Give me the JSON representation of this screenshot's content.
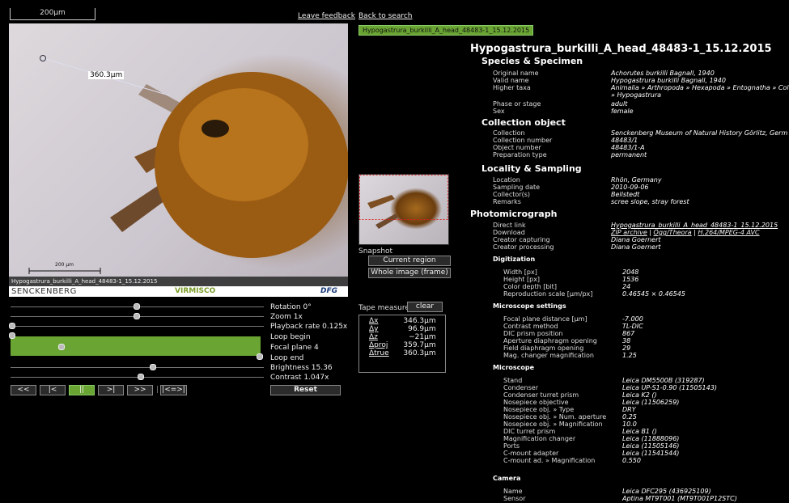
{
  "viewer": {
    "scale_top": "200μm",
    "scale_bottom": "200 μm",
    "measure_label": "360.3μm",
    "caption": "Hypogastrura_burkilli_A_head_48483-1_15.12.2015",
    "logo_left": "SENCKENBERG",
    "logo_mid": "VIRMISCO",
    "logo_right": "DFG"
  },
  "links": {
    "feedback": "Leave feedback",
    "back": "Back to search"
  },
  "tag": "Hypogastrura_burkilli_A_head_48483-1_15.12.2015",
  "snapshot": {
    "label": "Snapshot",
    "current": "Current region",
    "whole": "Whole image (frame)"
  },
  "controls": {
    "rotation": "Rotation 0°",
    "zoom": "Zoom 1x",
    "playback": "Playback rate 0.125x",
    "loop_begin": "Loop begin",
    "focal_plane": "Focal plane 4",
    "loop_end": "Loop end",
    "brightness": "Brightness 15.36",
    "contrast": "Contrast 1.047x",
    "buttons": [
      "<<",
      "|<",
      "||",
      ">|",
      ">>",
      "|<=>|"
    ],
    "reset": "Reset"
  },
  "tape": {
    "label": "Tape measure",
    "clear": "clear",
    "rows": [
      {
        "k": "Δx",
        "v": "346.3μm"
      },
      {
        "k": "Δy",
        "v": "96.9μm"
      },
      {
        "k": "Δz",
        "v": "−21μm"
      },
      {
        "k": "Δproj",
        "v": "359.7μm"
      },
      {
        "k": "Δtrue",
        "v": "360.3μm"
      }
    ]
  },
  "details": {
    "title": "Hypogastrura_burkilli_A_head_48483-1_15.12.2015",
    "species_h": "Species & Specimen",
    "original_name_k": "Original name",
    "original_name_v": "Achorutes burkilli Bagnall, 1940",
    "valid_name_k": "Valid name",
    "valid_name_v": "Hypogastrura burkilli Bagnall, 1940",
    "higher_taxa_k": "Higher taxa",
    "higher_taxa_v": "Animalia » Arthropoda » Hexapoda » Entognatha » Col",
    "higher_taxa_v2": "» Hypogastrura",
    "phase_k": "Phase or stage",
    "phase_v": "adult",
    "sex_k": "Sex",
    "sex_v": "female",
    "collection_h": "Collection object",
    "collection_k": "Collection",
    "collection_v": "Senckenberg Museum of Natural History Görlitz, Germ",
    "colnum_k": "Collection number",
    "colnum_v": "48483/1",
    "objnum_k": "Object number",
    "objnum_v": "48483/1-A",
    "prep_k": "Preparation type",
    "prep_v": "permanent",
    "locality_h": "Locality & Sampling",
    "location_k": "Location",
    "location_v": "Rhön, Germany",
    "date_k": "Sampling date",
    "date_v": "2010-09-06",
    "collector_k": "Collector(s)",
    "collector_v": "Bellstedt",
    "remarks_k": "Remarks",
    "remarks_v": "scree slope, stray forest",
    "photo_h": "Photomicrograph",
    "direct_k": "Direct link",
    "direct_v": "Hypogastrura_burkilli_A_head_48483-1_15.12.2015",
    "download_k": "Download",
    "download_zip": "ZIP archive",
    "download_ogg": "Ogg/Theora",
    "download_h264": "H.264/MPEG-4 AVC",
    "capturing_k": "Creator capturing",
    "capturing_v": "Diana Goernert",
    "processing_k": "Creator processing",
    "processing_v": "Diana Goernert",
    "digit_h": "Digitization",
    "width_k": "Width [px]",
    "width_v": "2048",
    "height_k": "Height [px]",
    "height_v": "1536",
    "depth_k": "Color depth [bit]",
    "depth_v": "24",
    "repro_k": "Reproduction scale [μm/px]",
    "repro_v": "0.46545 × 0.46545",
    "micset_h": "Microscope settings",
    "focal_k": "Focal plane distance [μm]",
    "focal_v": "-7.000",
    "contrast_k": "Contrast method",
    "contrast_v": "TL-DIC",
    "dicpos_k": "DIC prism position",
    "dicpos_v": "867",
    "aperture_k": "Aperture diaphragm opening",
    "aperture_v": "38",
    "field_k": "Field diaphragm opening",
    "field_v": "29",
    "magch_k": "Mag. changer magnification",
    "magch_v": "1.25",
    "mic_h": "Microscope",
    "stand_k": "Stand",
    "stand_v": "Leica DM5500B (319287)",
    "cond_k": "Condenser",
    "cond_v": "Leica UP-S1-0.90 (11505143)",
    "condprism_k": "Condenser turret prism",
    "condprism_v": "Leica K2 ()",
    "nosepiece_k": "Nosepiece objective",
    "nosepiece_v": "Leica (11506259)",
    "type_k": "Nosepiece obj. » Type",
    "type_v": "DRY",
    "na_k": "Nosepiece obj. » Num. aperture",
    "na_v": "0.25",
    "mag_k": "Nosepiece obj. » Magnification",
    "mag_v": "10.0",
    "dicturret_k": "DIC turret prism",
    "dicturret_v": "Leica B1 ()",
    "magchanger_k": "Magnification changer",
    "magchanger_v": "Leica (11888096)",
    "ports_k": "Ports",
    "ports_v": "Leica (11505146)",
    "cmount_k": "C-mount adapter",
    "cmount_v": "Leica (11541544)",
    "cmountmag_k": "C-mount ad. » Magnification",
    "cmountmag_v": "0.550",
    "camera_h": "Camera",
    "name_k": "Name",
    "name_v": "Leica DFC295 (436925109)",
    "sensor_k": "Sensor",
    "sensor_v": "Aptina MT9T001 (MT9T001P12STC)"
  }
}
